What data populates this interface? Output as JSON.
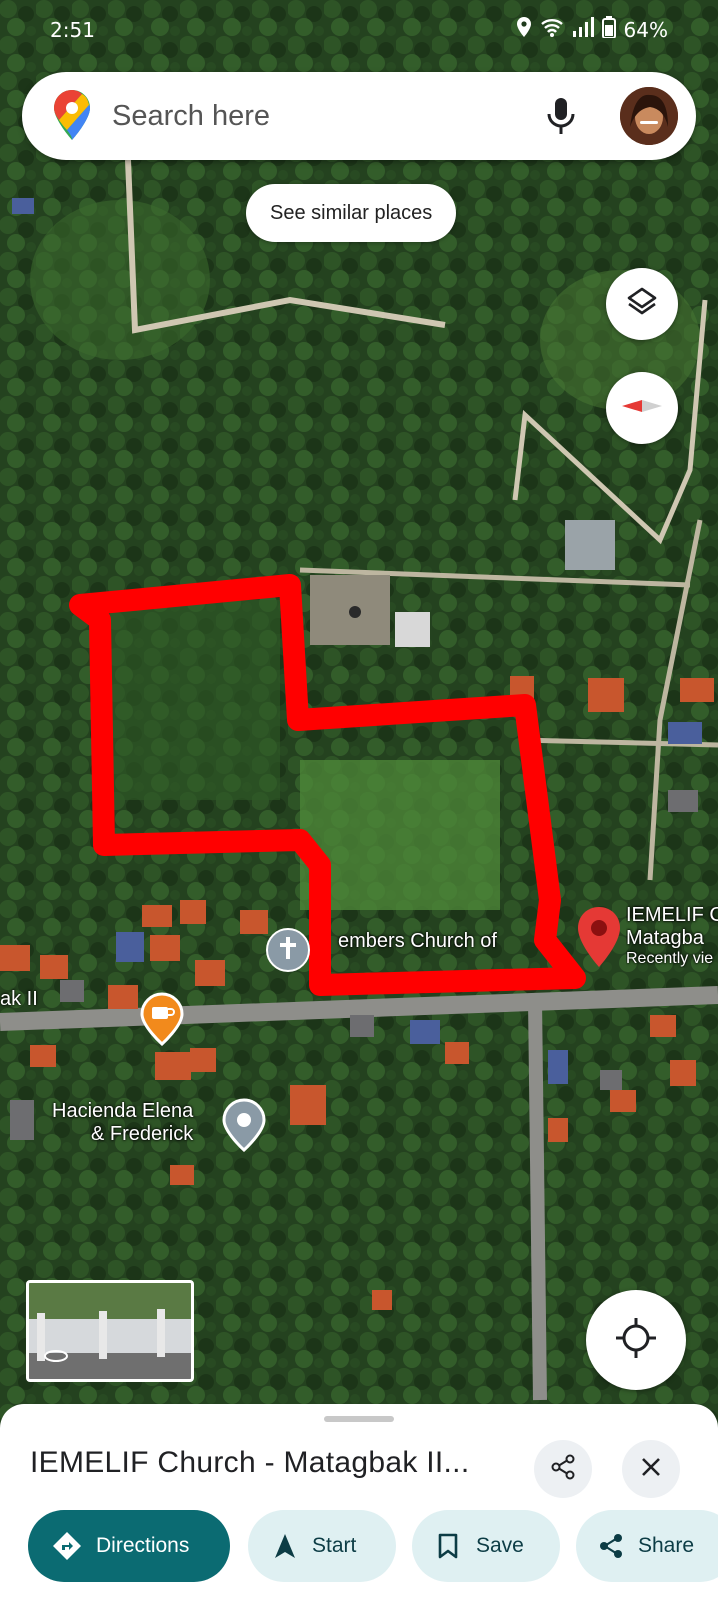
{
  "status_bar": {
    "time": "2:51",
    "battery": "64%",
    "icons": [
      "location-icon",
      "wifi-icon",
      "signal-icon",
      "battery-icon"
    ]
  },
  "search": {
    "placeholder": "Search here",
    "icons": [
      "google-maps-logo",
      "microphone-icon",
      "avatar"
    ]
  },
  "chip": {
    "label": "See similar places"
  },
  "map_controls": [
    "layers-icon",
    "compass-icon",
    "my-location-icon"
  ],
  "map_labels": {
    "church_partial": "embers Church of",
    "road_partial": "ak II",
    "hacienda_line1": "Hacienda Elena",
    "hacienda_line2": "& Frederick",
    "pin_title_line1": "IEMELIF C",
    "pin_title_line2": "Matagba",
    "pin_subtitle": "Recently vie"
  },
  "colors": {
    "accent": "#0b6b72",
    "secondary_button": "#dff0f2",
    "pin_red": "#e53935",
    "drawn_outline": "#ff0000",
    "cafe_orange": "#f28a1c"
  },
  "sheet": {
    "title": "IEMELIF Church - Matagbak II...",
    "actions": [
      {
        "label": "Directions",
        "icon": "directions-icon"
      },
      {
        "label": "Start",
        "icon": "navigation-arrow-icon"
      },
      {
        "label": "Save",
        "icon": "bookmark-icon"
      },
      {
        "label": "Share",
        "icon": "share-icon"
      }
    ],
    "header_icons": [
      "share-icon",
      "close-icon"
    ]
  }
}
